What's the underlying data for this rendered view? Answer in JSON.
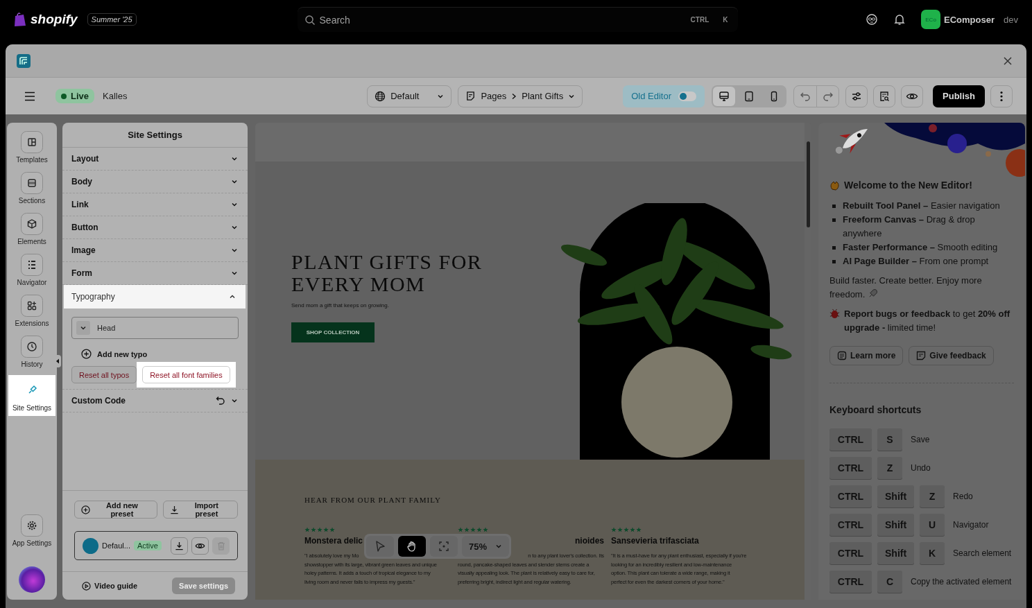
{
  "topbar": {
    "brand": "shopify",
    "edition": "Summer '25",
    "search": {
      "placeholder": "Search"
    },
    "shortcut": [
      "CTRL",
      "K"
    ],
    "store_badge": "ECo",
    "store_name": "EComposer",
    "store_role": "dev"
  },
  "editor_toolbar": {
    "status": "Live",
    "theme_name": "Kalles",
    "language": "Default",
    "page_type": "Pages",
    "page_name": "Plant Gifts",
    "old_editor": {
      "label": "Old Editor",
      "on": false
    },
    "devices": [
      {
        "kind": "desktop",
        "selected": true
      },
      {
        "kind": "tablet",
        "selected": false
      },
      {
        "kind": "mobile",
        "selected": false
      }
    ],
    "publish": "Publish"
  },
  "nav": [
    {
      "kind": "templates",
      "label": "Templates",
      "selected": false,
      "highlighted": false
    },
    {
      "kind": "sections",
      "label": "Sections",
      "selected": false,
      "highlighted": false
    },
    {
      "kind": "elements",
      "label": "Elements",
      "selected": false,
      "highlighted": false
    },
    {
      "kind": "navigator",
      "label": "Navigator",
      "selected": false,
      "highlighted": false
    },
    {
      "kind": "extensions",
      "label": "Extensions",
      "selected": false,
      "highlighted": false
    },
    {
      "kind": "history",
      "label": "History",
      "selected": false,
      "highlighted": false
    },
    {
      "kind": "site_settings",
      "label": "Site Settings",
      "selected": true,
      "highlighted": true
    }
  ],
  "app_settings": "App Settings",
  "site_settings": {
    "title": "Site Settings",
    "sections": [
      {
        "label": "Layout",
        "expanded": false,
        "highlighted": false,
        "has_reset": false
      },
      {
        "label": "Body",
        "expanded": false,
        "highlighted": false,
        "has_reset": false
      },
      {
        "label": "Link",
        "expanded": false,
        "highlighted": false,
        "has_reset": false
      },
      {
        "label": "Button",
        "expanded": false,
        "highlighted": false,
        "has_reset": false
      },
      {
        "label": "Image",
        "expanded": false,
        "highlighted": false,
        "has_reset": false
      },
      {
        "label": "Form",
        "expanded": false,
        "highlighted": false,
        "has_reset": false
      },
      {
        "label": "Typography",
        "expanded": true,
        "highlighted": true,
        "has_reset": false
      },
      {
        "label": "Custom Code",
        "expanded": false,
        "highlighted": false,
        "has_reset": true
      }
    ],
    "typography": {
      "groups": [
        {
          "label": "Head",
          "expanded": false
        }
      ],
      "add": "Add new typo",
      "reset_typos": {
        "label": "Reset all typos",
        "highlighted": false
      },
      "reset_fonts": {
        "label": "Reset all font families",
        "highlighted": true
      }
    },
    "presets": {
      "add": "Add new preset",
      "import": "Import preset",
      "items": [
        {
          "name": "Defaul...",
          "color": "#0d6b88",
          "status": "Active"
        }
      ]
    },
    "footer": {
      "video": "Video guide",
      "save": {
        "label": "Save settings",
        "disabled": true
      }
    }
  },
  "canvas": {
    "hero": {
      "title_lines": [
        "PLANT GIFTS FOR",
        "EVERY MOM"
      ],
      "subtitle": "Send mom a gift that keeps on growing.",
      "button": "SHOP COLLECTION"
    },
    "testimonials": {
      "heading": "HEAR FROM OUR PLANT FAMILY",
      "items": [
        {
          "stars": 5,
          "title": "Monstera delic",
          "lines": [
            "\"I absolutely love my Mo",
            "showstopper with its large, vibrant green leaves and unique",
            "holey patterns. It adds a touch of tropical elegance to my",
            "living room and never fails to impress my guests.\""
          ]
        },
        {
          "stars": 5,
          "title": "nioides",
          "lines": [
            "n to any plant lover's collection. Its",
            "round, pancake-shaped leaves and slender stems create a",
            "visually appealing look. The plant is relatively easy to care for,",
            "preferring bright, indirect light and regular watering."
          ]
        },
        {
          "stars": 5,
          "title": "Sansevieria trifasciata",
          "lines": [
            "\"It is a must-have for any plant enthusiast, especially if you're",
            "looking for an incredibly resilient and low-maintenance",
            "option. This plant can tolerate a wide range, making it",
            "perfect for even the darkest corners of your home.\""
          ]
        }
      ]
    },
    "floating_tools": {
      "tools": [
        {
          "kind": "select",
          "selected": false
        },
        {
          "kind": "hand",
          "selected": true
        },
        {
          "kind": "focus",
          "selected": false
        }
      ],
      "zoom": "75%"
    }
  },
  "welcome": {
    "title": "Welcome to the New Editor!",
    "features": [
      "**Rebuilt Tool Panel –** Easier navigation",
      "**Freeform Canvas –** Drag & drop anywhere",
      "**Faster Performance –** Smooth editing",
      "**AI Page Builder –** From one prompt"
    ],
    "tagline": "Build faster. Create better. Enjoy more freedom.",
    "promo": "**Report bugs or feedback** to get **20% off upgrade -** limited time!",
    "buttons": [
      {
        "kind": "learn",
        "label": "Learn more"
      },
      {
        "kind": "feedback",
        "label": "Give feedback"
      }
    ],
    "shortcuts_title": "Keyboard shortcuts",
    "shortcuts": [
      {
        "keys": [
          "CTRL",
          "S"
        ],
        "label": "Save"
      },
      {
        "keys": [
          "CTRL",
          "Z"
        ],
        "label": "Undo"
      },
      {
        "keys": [
          "CTRL",
          "Shift",
          "Z"
        ],
        "label": "Redo"
      },
      {
        "keys": [
          "CTRL",
          "Shift",
          "U"
        ],
        "label": "Navigator"
      },
      {
        "keys": [
          "CTRL",
          "Shift",
          "K"
        ],
        "label": "Search element"
      },
      {
        "keys": [
          "CTRL",
          "C"
        ],
        "label": "Copy the activated element"
      }
    ]
  }
}
